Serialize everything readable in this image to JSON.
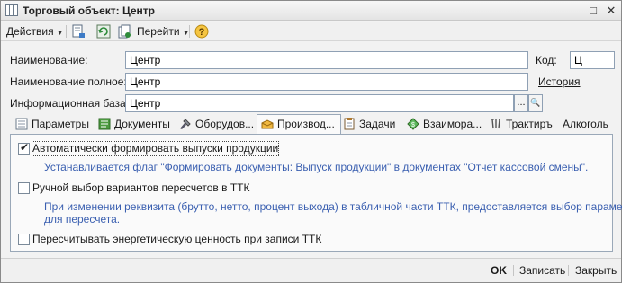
{
  "window": {
    "title": "Торговый объект: Центр",
    "maximize_glyph": "□",
    "close_glyph": "✕"
  },
  "toolbar": {
    "actions_label": "Действия",
    "goto_label": "Перейти",
    "dropdown_glyph": "▼",
    "icons": [
      "post-icon",
      "refresh-icon",
      "copy-document-icon",
      "help-icon"
    ]
  },
  "form": {
    "name_label": "Наименование:",
    "name_value": "Центр",
    "code_label": "Код:",
    "code_value": "Ц",
    "fullname_label": "Наименование полное:",
    "fullname_value": "Центр",
    "history_link": "История",
    "infobase_label": "Информационная база:",
    "infobase_value": "Центр",
    "choose_glyph": "...",
    "search_glyph": "🔍"
  },
  "tabs": [
    {
      "label": "Параметры",
      "icon": "parameters-icon"
    },
    {
      "label": "Документы",
      "icon": "documents-icon"
    },
    {
      "label": "Оборудов...",
      "icon": "equipment-icon"
    },
    {
      "label": "Производ...",
      "icon": "production-icon",
      "active": true
    },
    {
      "label": "Задачи",
      "icon": "tasks-icon"
    },
    {
      "label": "Взаимора...",
      "icon": "settlements-icon"
    },
    {
      "label": "Трактиръ",
      "icon": "tavern-icon"
    },
    {
      "label": "Алкоголь",
      "icon": ""
    }
  ],
  "production": {
    "auto_release": {
      "label": "Автоматически формировать выпуски продукции",
      "checked": true,
      "hint": "Устанавливается флаг \"Формировать документы: Выпуск продукции\" в документах \"Отчет кассовой смены\"."
    },
    "manual_variants": {
      "label": "Ручной выбор вариантов пересчетов в ТТК",
      "checked": false,
      "hint_line1": "При изменении реквизита (брутто, нетто, процент выхода) в табличной части ТТК, предоставляется выбор параметра",
      "hint_line2": "для пересчета."
    },
    "recalc_energy": {
      "label": "Пересчитывать энергетическую ценность при записи ТТК",
      "checked": false
    }
  },
  "footer": {
    "ok_label": "OK",
    "save_label": "Записать",
    "close_label": "Закрыть"
  },
  "colors": {
    "hint_text": "#3a5fb0",
    "border": "#9aa8b8"
  }
}
